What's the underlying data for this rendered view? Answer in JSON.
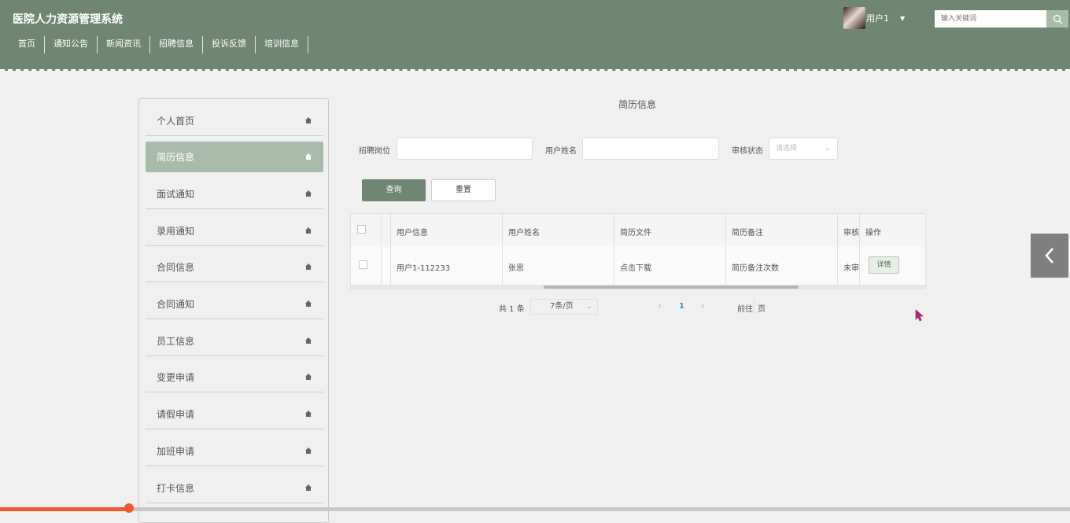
{
  "header": {
    "title": "医院人力资源管理系统",
    "nav": [
      "首页",
      "通知公告",
      "新闻资讯",
      "招聘信息",
      "投诉反馈",
      "培训信息"
    ],
    "user_name": "用户1",
    "search_placeholder": "输入关键词"
  },
  "sidebar": {
    "items": [
      {
        "label": "个人首页",
        "active": false
      },
      {
        "label": "简历信息",
        "active": true
      },
      {
        "label": "面试通知",
        "active": false
      },
      {
        "label": "录用通知",
        "active": false
      },
      {
        "label": "合同信息",
        "active": false
      },
      {
        "label": "合同通知",
        "active": false
      },
      {
        "label": "员工信息",
        "active": false
      },
      {
        "label": "变更申请",
        "active": false
      },
      {
        "label": "请假申请",
        "active": false
      },
      {
        "label": "加班申请",
        "active": false
      },
      {
        "label": "打卡信息",
        "active": false
      }
    ]
  },
  "main": {
    "title": "简历信息",
    "filters": {
      "position_label": "招聘岗位",
      "name_label": "用户姓名",
      "status_label": "审核状态",
      "status_placeholder": "请选择"
    },
    "buttons": {
      "query": "查询",
      "reset": "重置"
    },
    "table": {
      "columns": [
        "用户信息",
        "用户姓名",
        "简历文件",
        "简历备注",
        "审核",
        "操作"
      ],
      "rows": [
        {
          "user_info": "用户1-112233",
          "user_name": "张思",
          "resume_file": "点击下载",
          "resume_note": "简历备注次数",
          "status": "未审",
          "action": "详情"
        }
      ]
    },
    "pagination": {
      "total": "共 1 条",
      "page_size": "7条/页",
      "prev": "‹",
      "current": "1",
      "next": "›",
      "goto_label": "前往",
      "goto_suffix": "页"
    }
  },
  "colors": {
    "header_bg": "#6e8672",
    "accent": "#6e8672",
    "active_item": "#a9bcab"
  }
}
